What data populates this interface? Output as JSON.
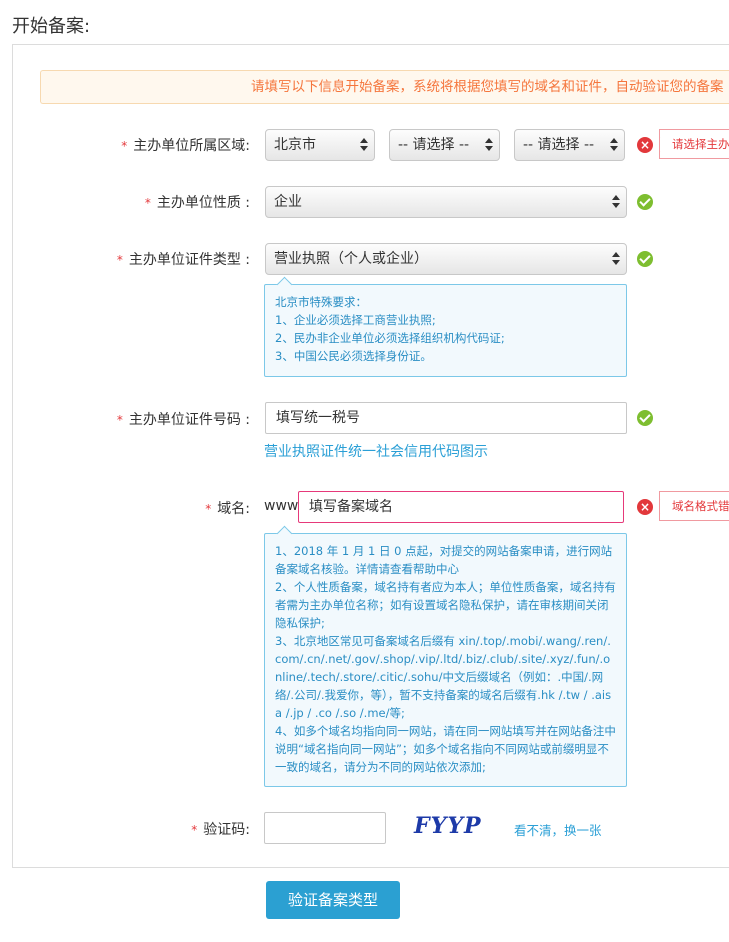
{
  "page_title": "开始备案:",
  "notice": "请填写以下信息开始备案，系统将根据您填写的域名和证件，自动验证您的备案",
  "fields": {
    "region": {
      "label": "主办单位所属区域:",
      "province": "北京市",
      "city": "-- 请选择 --",
      "district": "-- 请选择 --",
      "error": "请选择主办单位"
    },
    "org_type": {
      "label": "主办单位性质 :",
      "value": "企业"
    },
    "cert_type": {
      "label": "主办单位证件类型 :",
      "value": "营业执照（个人或企业）",
      "hint": [
        "北京市特殊要求：",
        "1、企业必须选择工商营业执照;",
        "2、民办非企业单位必须选择组织机构代码证;",
        "3、中国公民必须选择身份证。"
      ]
    },
    "cert_number": {
      "label": "主办单位证件号码 :",
      "placeholder": "填写统一税号",
      "link": "营业执照证件统一社会信用代码图示"
    },
    "domain": {
      "label": "域名:",
      "prefix": "www.",
      "placeholder": "填写备案域名",
      "error": "域名格式错误",
      "hint": {
        "p1_a": "1、2018 年 1 月 1 日 0 点起，对提交的网站备案申请，进行网站备案域名核验。详情请查看",
        "p1_link": "帮助中心",
        "p2": "2、个人性质备案，域名持有者应为本人；单位性质备案，域名持有者需为主办单位名称；如有设置域名隐私保护，请在审核期间关闭隐私保护;",
        "p3": "3、北京地区常见可备案域名后缀有 xin/.top/.mobi/.wang/.ren/.com/.cn/.net/.gov/.shop/.vip/.ltd/.biz/.club/.site/.xyz/.fun/.online/.tech/.store/.citic/.sohu/中文后缀域名（例如：.中国/.网络/.公司/.我爱你，等），暂不支持备案的域名后缀有.hk /.tw / .aisa /.jp / .co /.so /.me/等;",
        "p4": "4、如多个域名均指向同一网站，请在同一网站填写并在网站备注中说明“域名指向同一网站”；如多个域名指向不同网站或前缀明显不一致的域名，请分为不同的网站依次添加;"
      }
    },
    "captcha": {
      "label": "验证码:",
      "value": "",
      "image_text": "FYYP",
      "refresh": "看不清，换一张"
    }
  },
  "submit": "验证备案类型",
  "colors": {
    "accent": "#2ba0d2",
    "error": "#e2383b",
    "ok": "#7ebe30",
    "notice": "#f5763d"
  }
}
